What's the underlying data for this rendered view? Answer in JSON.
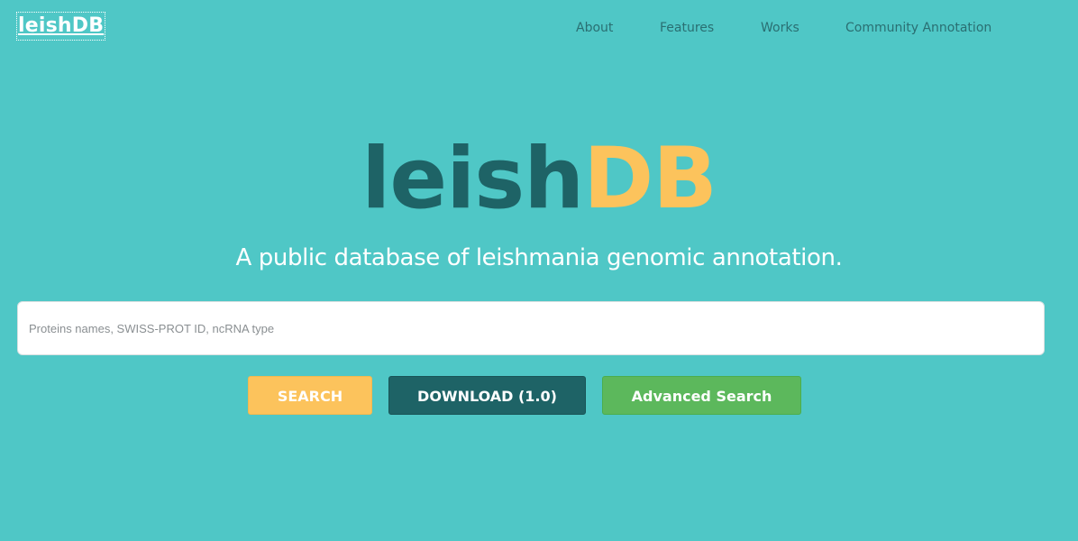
{
  "brand": "leishDB",
  "nav": {
    "items": [
      "About",
      "Features",
      "Works",
      "Community Annotation"
    ]
  },
  "hero": {
    "title_part1": "leish",
    "title_part2": "DB",
    "tagline": "A public database of leishmania genomic annotation."
  },
  "search": {
    "placeholder": "Proteins names, SWISS-PROT ID, ncRNA type",
    "value": ""
  },
  "buttons": {
    "search": "SEARCH",
    "download": "DOWNLOAD (1.0)",
    "advanced": "Advanced Search"
  },
  "colors": {
    "background": "#4fc7c6",
    "title_dark": "#1e6366",
    "title_accent": "#fcc35c",
    "advanced_green": "#5cb85c"
  }
}
